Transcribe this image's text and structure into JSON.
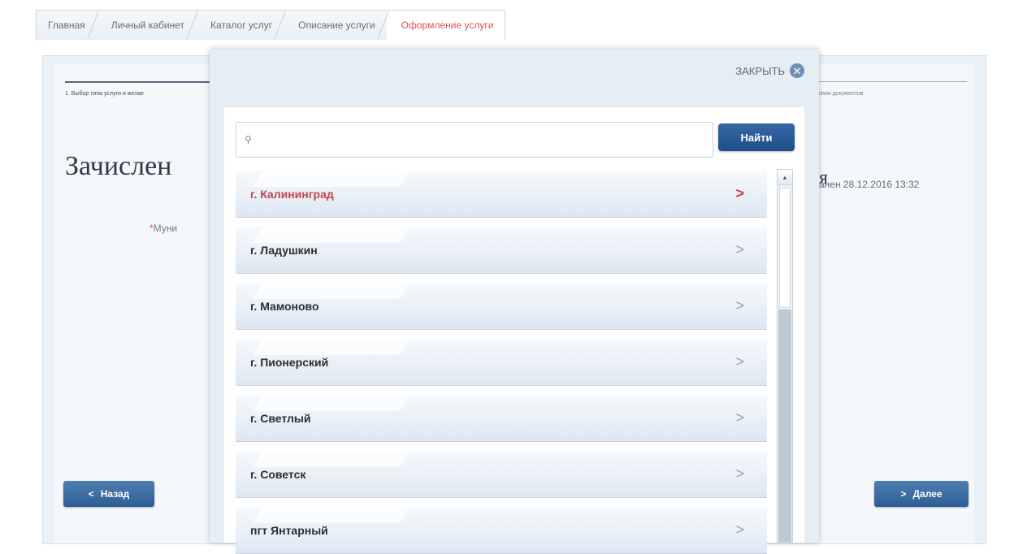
{
  "breadcrumb": {
    "items": [
      {
        "label": "Главная"
      },
      {
        "label": "Личный кабинет"
      },
      {
        "label": "Каталог услуг"
      },
      {
        "label": "Описание услуги"
      },
      {
        "label": "Оформление услуги"
      }
    ],
    "active_index": 4
  },
  "background_page": {
    "step_left": "1. Выбор типа услуги и желае",
    "step_right": "копии документов",
    "title_left": "Зачислен",
    "title_right": "я",
    "updated": "анен 28.12.2016 13:32",
    "field_label": "Муни",
    "field_required_mark": "*",
    "back_button": "Назад",
    "next_button": "Далее"
  },
  "modal": {
    "close_label": "ЗАКРЫТЬ",
    "search": {
      "value": "",
      "placeholder": ""
    },
    "find_button": "Найти",
    "items": [
      {
        "label": "г. Калининград",
        "selected": true
      },
      {
        "label": "г. Ладушкин",
        "selected": false
      },
      {
        "label": "г. Мамоново",
        "selected": false
      },
      {
        "label": "г. Пионерский",
        "selected": false
      },
      {
        "label": "г. Светлый",
        "selected": false
      },
      {
        "label": "г. Советск",
        "selected": false
      },
      {
        "label": "пгт Янтарный",
        "selected": false
      }
    ]
  },
  "colors": {
    "accent_red": "#d13a47",
    "button_blue": "#2e5d94"
  },
  "icons": {
    "search": "search-icon",
    "close": "close-icon",
    "chevron": "chevron-right-icon"
  }
}
